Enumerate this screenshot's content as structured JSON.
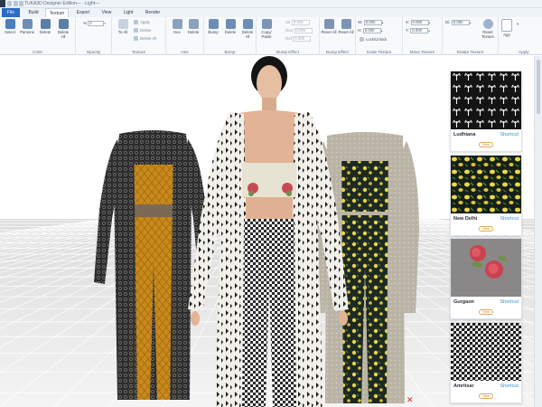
{
  "app": {
    "title": "TUKA3D Designer Edition— · Light—"
  },
  "tabs": [
    "File",
    "Build",
    "Texture",
    "Export",
    "View",
    "Light",
    "Render"
  ],
  "active_tab": "Texture",
  "ribbon": {
    "color": {
      "label": "Color",
      "buttons": [
        "Select",
        "Pantone",
        "Delete",
        "Delete All"
      ]
    },
    "opacity": {
      "label": "Opacity",
      "value": "0"
    },
    "texture": {
      "label": "Texture",
      "button": "To All",
      "small": [
        "Apply",
        "Delete",
        "Delete All"
      ]
    },
    "hex": {
      "label": "Hex",
      "buttons": [
        "Hex",
        "Delete"
      ]
    },
    "bump": {
      "label": "Bump",
      "buttons": [
        "Bump",
        "Delete",
        "Delete All"
      ]
    },
    "bump_effect": {
      "label": "Bump Effect",
      "button": "Copy/ Paste",
      "fields": [
        {
          "name": "Str",
          "value": "0.000"
        },
        {
          "name": "Rou",
          "value": "0.000"
        },
        {
          "name": "Ref",
          "value": "0.000"
        }
      ],
      "fields2": [
        {
          "name": "Sh",
          "value": "0.000"
        },
        {
          "name": "Re",
          "value": "0.000"
        },
        {
          "name": "Ro",
          "value": "0.000"
        }
      ]
    },
    "bump_effect2": {
      "label": "Bump Effect",
      "buttons": [
        "Reset All",
        "Reset All"
      ]
    },
    "scale_texture": {
      "label": "Scale Texture",
      "fields": [
        {
          "name": "W",
          "value": "0.000"
        },
        {
          "name": "H",
          "value": "0.000"
        }
      ],
      "lock": "Lock/Unlock"
    },
    "move_texture": {
      "label": "Move Texture",
      "fields": [
        {
          "name": "X",
          "value": "0.000"
        },
        {
          "name": "Y",
          "value": "0.000"
        }
      ]
    },
    "rotate_texture": {
      "label": "Rotate Texture",
      "fields": [
        {
          "name": "Di",
          "value": "0.000"
        }
      ],
      "button": "Reset Texture"
    },
    "apply": {
      "label": "Apply",
      "button": "App"
    }
  },
  "fabrics": [
    {
      "name": "Ludhiana",
      "shortcut": "Shortcut",
      "view": "View"
    },
    {
      "name": "New Delhi",
      "shortcut": "Shortcut",
      "view": "View"
    },
    {
      "name": "Gurgaon",
      "shortcut": "Shortcut",
      "view": "View"
    },
    {
      "name": "Amritsar",
      "shortcut": "Shortcut",
      "view": "View"
    }
  ],
  "colors": {
    "accent": "#2d6cc4",
    "ribbon_bg": "#f7f9fb",
    "shortcut": "#3a8fd0",
    "mustard": "#c98a1c"
  }
}
